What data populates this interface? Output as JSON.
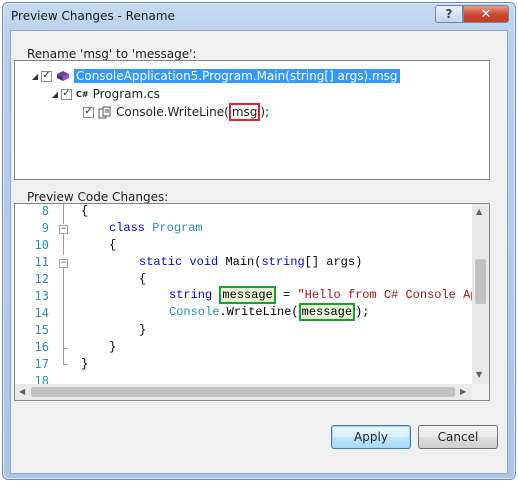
{
  "window": {
    "title": "Preview Changes - Rename",
    "help_glyph": "?",
    "close_glyph": "✕"
  },
  "rename_section": {
    "label": "Rename 'msg' to 'message':",
    "tree": [
      {
        "id": "project",
        "text": "ConsoleApplication5.Program.Main(string[] args).msg",
        "checked": true,
        "expanded": true,
        "selected": true
      },
      {
        "id": "file",
        "text": "Program.cs",
        "checked": true,
        "expanded": true,
        "icon_glyph": "C#"
      },
      {
        "id": "reference",
        "prefix": "Console.WriteLine(",
        "highlight": "msg",
        "suffix": ");",
        "checked": true
      }
    ]
  },
  "preview_section": {
    "label": "Preview Code Changes:",
    "line_numbers": [
      "8",
      "9",
      "10",
      "11",
      "12",
      "13",
      "14",
      "15",
      "16",
      "17",
      "18"
    ],
    "code": {
      "l8": "{",
      "l9_kw": "class",
      "l9_type": "Program",
      "l10": "{",
      "l11_static": "static",
      "l11_void": "void",
      "l11_main": "Main(",
      "l11_string": "string",
      "l11_args": "[] args)",
      "l12": "{",
      "l13_kw": "string",
      "l13_var": "message",
      "l13_eq": " = ",
      "l13_str": "\"Hello from C# Console App\";",
      "l14_console": "Console",
      "l14_dot": ".WriteLine(",
      "l14_var": "message",
      "l14_end": ");",
      "l15": "}",
      "l16": "}",
      "l17": "}"
    }
  },
  "buttons": {
    "apply": "Apply",
    "cancel": "Cancel"
  },
  "colors": {
    "selection": "#3399ff",
    "old_highlight": "#e0242b",
    "new_highlight": "#1e9e3a",
    "keyword": "#0000ff",
    "type": "#2b91af",
    "string": "#a31515"
  }
}
